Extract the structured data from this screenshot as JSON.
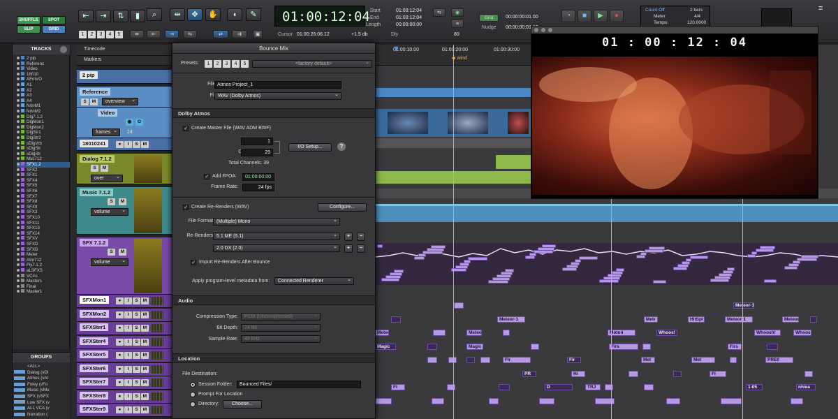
{
  "toolbar": {
    "modes": [
      "SHUFFLE",
      "SPOT",
      "SLIP",
      "GRID"
    ],
    "counter_main": "01:00:12:04",
    "start_label": "Start",
    "end_label": "End",
    "length_label": "Length",
    "start": "01:00:12:04",
    "end": "01:00:12:04",
    "length": "00:00:00:00",
    "cursor_label": "Cursor",
    "cursor": "01:00:25:06.12",
    "nudge_label": "Nudge",
    "nudge": "00:00:00:01.00",
    "grid_label": "Grid",
    "grid": "00:00:00:01.00",
    "dly_label": "Dly",
    "dly_value": "80",
    "offset": "+1.5 db",
    "count_off": "Count Off",
    "bars": "2 bars",
    "meter_label": "Meter",
    "meter_value": "4/4",
    "tempo_label": "Tempo",
    "tempo_value": "120.0000",
    "numbers": [
      "1",
      "2",
      "3",
      "4",
      "5"
    ]
  },
  "track_list": {
    "title": "TRACKS",
    "items": [
      "2 pip",
      "Referenc",
      "Video",
      "18010",
      "AFmVO",
      "A1",
      "A2",
      "A3",
      "A4",
      "NrtnM1",
      "NrtnM2",
      "Dlg7.1.2",
      "DlgMon1",
      "DlgMon2",
      "DlgStr1",
      "DlgStr2",
      "sDlgVrb",
      "sDlgStr",
      "sDlgStr",
      "Msc712",
      "SFX1.2",
      "SFX2",
      "SFX1",
      "SFX4",
      "SFX5",
      "SFX6",
      "SFX7",
      "SFX8",
      "SFX9",
      "SFX3",
      "SFX10",
      "SFX11",
      "SFX13",
      "SFX14",
      "SFXV",
      "SFXD",
      "SFXD",
      "Meter",
      "Atm712",
      "Fly7.1.2",
      "aLSFXS",
      "VCAs",
      "Masters",
      "Final",
      "Master1"
    ]
  },
  "groups": {
    "title": "GROUPS",
    "items": [
      "<ALL>",
      "Dialog (vDI",
      "Atmos (vAt",
      "Foley (vFo",
      "Music (vMu",
      "SFX (vSFX",
      "Low SFX (v",
      "ALL VCA (v",
      "Narration ("
    ]
  },
  "ruler": {
    "timecode_label": "Timecode",
    "markers_label": "Markers",
    "t1": "01:00:10:00",
    "t2": "01:00:20:00",
    "t3": "01:00:30:00",
    "marker": "wind"
  },
  "track_headers": [
    {
      "name": "2 pip"
    },
    {
      "name": "Reference",
      "sub": "overview"
    },
    {
      "name": "Video",
      "sub": "frames",
      "num": "24"
    },
    {
      "name": "18010241"
    },
    {
      "name": "Dialog 7.1.2",
      "sub": "over"
    },
    {
      "name": "Music 7.1.2",
      "sub": "volume"
    },
    {
      "name": "SFX 7.1.2",
      "sub": "volume"
    },
    {
      "name": "SFXMon1"
    },
    {
      "name": "SFXMon2"
    },
    {
      "name": "SFXSter1"
    },
    {
      "name": "SFXSter4"
    },
    {
      "name": "SFXSter5"
    },
    {
      "name": "SFXSter6"
    },
    {
      "name": "SFXSter7"
    },
    {
      "name": "SFXSter8"
    },
    {
      "name": "SFXSter9"
    }
  ],
  "clip_labels": [
    "Meteor-1",
    "Meteor-1",
    "Metr",
    "HitSpl",
    "Meteor-1",
    "Meteor-1",
    "Meteor-",
    "Meteor-2",
    "Moton",
    "Whoos!",
    "Whoosh!",
    "WhooshFlx",
    "Magic",
    "Magic",
    "Firs",
    "Firs",
    "Flr",
    "Flr",
    "Met",
    "Met",
    "PRE0",
    "PR",
    "Hi",
    "Fl",
    "Fl",
    "D",
    "TRJ",
    "1-05",
    "nhiea"
  ],
  "dialog": {
    "title": "Bounce Mix",
    "presets_label": "Presets:",
    "preset_nums": [
      "1",
      "2",
      "3",
      "4",
      "5"
    ],
    "preset_value": "<factory default>",
    "file_name_label": "File Name:",
    "file_name": "Atmos Project_1",
    "file_type_label": "File Type:",
    "file_type": "WAV (Dolby Atmos)",
    "dolby_section": "Dolby Atmos",
    "create_master_label": "Create Master File (WAV ADM BWF)",
    "beds_label": "Beds:",
    "beds": "1",
    "objects_label": "Objects:",
    "objects": "29",
    "io_setup": "I/O Setup...",
    "total_channels": "Total Channels: 39",
    "add_ffoa_label": "Add FFOA:",
    "ffoa": "01:00:00:00",
    "frame_rate_label": "Frame Rate:",
    "frame_rate": "24 fps",
    "create_rerenders_label": "Create Re-Renders (WAV)",
    "configure": "Configure...",
    "file_format_label": "File Format:",
    "file_format": "(Multiple) Mono",
    "rerenders_label": "Re-Renders:",
    "rerender1": "5.1 ME (5.1)",
    "rerender2": "2.0 DX (2.0)",
    "import_label": "Import Re-Renders After Bounce",
    "apply_label": "Apply program-level metadata from:",
    "apply_value": "Connected Renderer",
    "audio_section": "Audio",
    "compression_label": "Compression Type:",
    "compression": "PCM (Uncompressed)",
    "bitdepth_label": "Bit Depth:",
    "bitdepth": "24 Bit",
    "samplerate_label": "Sample Rate:",
    "samplerate": "48 kHz",
    "location_section": "Location",
    "file_dest_label": "File Destination:",
    "session_folder_label": "Session Folder:",
    "session_folder": "Bounced Files/",
    "prompt_label": "Prompt For Location",
    "directory_label": "Directory:",
    "choose": "Choose..."
  },
  "video": {
    "timecode": "01 : 00 : 12 : 04"
  }
}
